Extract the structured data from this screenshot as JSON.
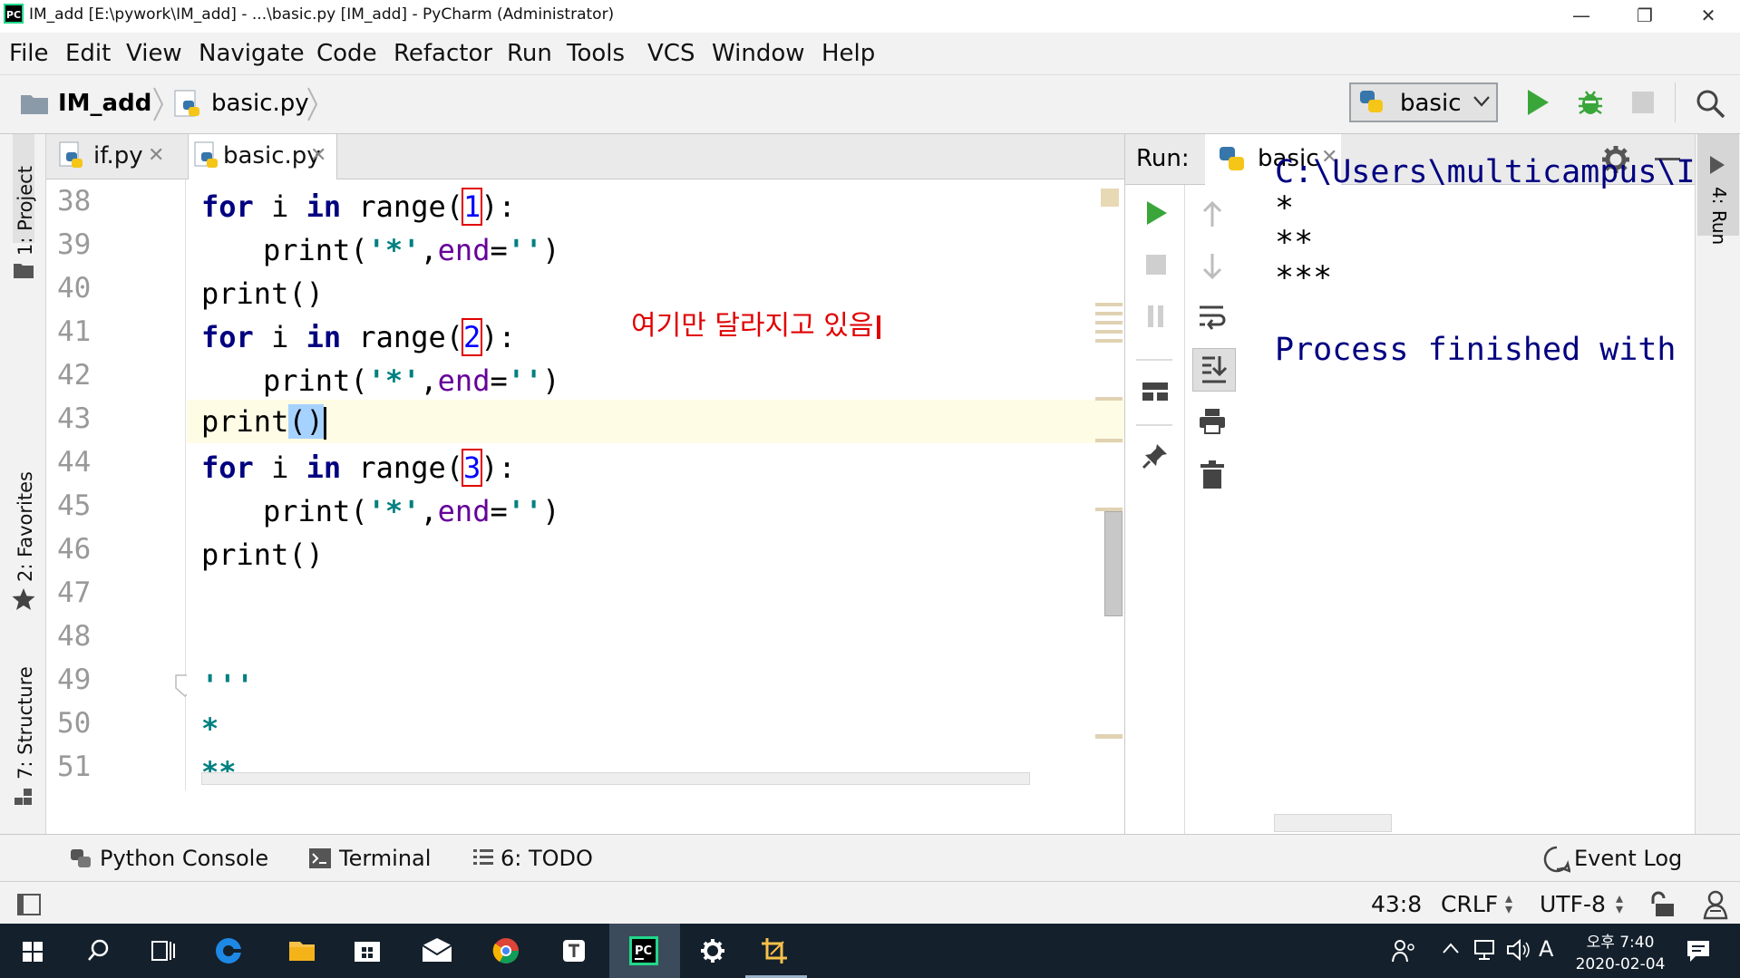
{
  "window": {
    "title": "IM_add [E:\\pywork\\IM_add] - ...\\basic.py [IM_add] - PyCharm (Administrator)",
    "app_icon_text": "PC",
    "minimize": "—",
    "restore": "❐",
    "close": "✕"
  },
  "menu": [
    "File",
    "Edit",
    "View",
    "Navigate",
    "Code",
    "Refactor",
    "Run",
    "Tools",
    "VCS",
    "Window",
    "Help"
  ],
  "breadcrumb": {
    "project": "IM_add",
    "file": "basic.py"
  },
  "toolbar": {
    "run_config": "basic"
  },
  "sidebar_left": {
    "project": "1: Project",
    "favorites": "2: Favorites",
    "structure": "7: Structure"
  },
  "editor_tabs": [
    {
      "label": "if.py",
      "active": false
    },
    {
      "label": "basic.py",
      "active": true
    }
  ],
  "editor": {
    "line_numbers": [
      "38",
      "39",
      "40",
      "41",
      "42",
      "43",
      "44",
      "45",
      "46",
      "47",
      "48",
      "49",
      "50",
      "51"
    ],
    "current_line": "43",
    "code": {
      "for": "for",
      "i": " i ",
      "in": "in",
      "range_open": " range(",
      "close_colon": "):",
      "print_star_open": "print(",
      "star_str": "'*'",
      "comma": ",",
      "end_kw": "end",
      "eq": "=",
      "empty_str": "''",
      "close_paren": ")",
      "print_empty": "print()",
      "print_call": "print",
      "paren_pair": "()",
      "triple_quote": "'''",
      "star1": "*",
      "star2": "**",
      "n1": "1",
      "n2": "2",
      "n3": "3"
    },
    "annotation": "여기만 달라지고 있음"
  },
  "run_panel": {
    "label": "Run:",
    "tab": "basic",
    "side_label": "4: Run",
    "output": [
      "C:\\Users\\multicampus\\I",
      "*",
      "**",
      "***",
      "",
      "Process finished with e"
    ]
  },
  "bottom_tools": {
    "python_console": "Python Console",
    "terminal": "Terminal",
    "todo": "6: TODO",
    "event_log": "Event Log"
  },
  "status": {
    "position": "43:8",
    "line_sep": "CRLF",
    "encoding": "UTF-8"
  },
  "taskbar": {
    "time": "오후 7:40",
    "date": "2020-02-04",
    "ime": "A"
  },
  "colors": {
    "keyword": "#000080",
    "string": "#008080",
    "kwarg": "#660099",
    "number": "#0000ff",
    "annotation": "#e00000",
    "run_green": "#3aa63a"
  }
}
